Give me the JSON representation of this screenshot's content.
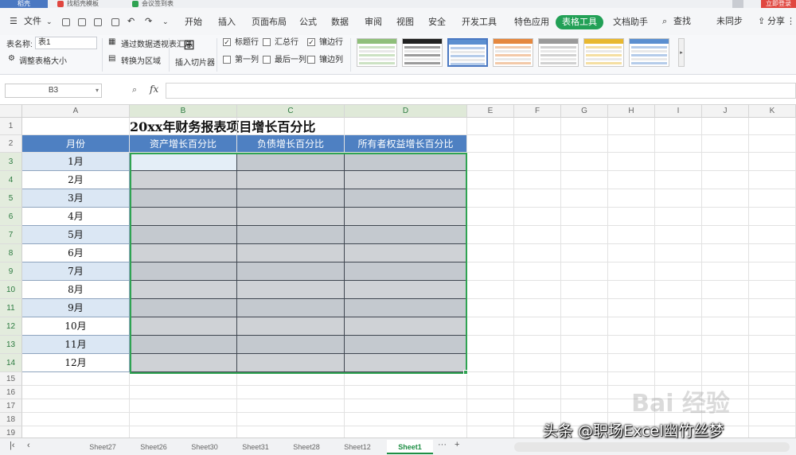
{
  "titlebar": {
    "home_tab": "稻壳",
    "doc_tabs": [
      {
        "label": "找稻壳模板",
        "color": "#e0463f"
      },
      {
        "label": "会议签到表",
        "color": "#2fa352"
      }
    ],
    "login_button": "立即登录"
  },
  "menubar": {
    "quick": "文件",
    "items": [
      "开始",
      "插入",
      "页面布局",
      "公式",
      "数据",
      "审阅",
      "视图",
      "安全",
      "开发工具",
      "特色应用",
      "表格工具",
      "文档助手"
    ],
    "active_index": 10,
    "search": "查找",
    "unsync": "未同步",
    "share": "分享"
  },
  "ribbon": {
    "table_name_label": "表名称:",
    "table_name_value": "表1",
    "resize_table": "调整表格大小",
    "summary_pivot": "通过数据透视表汇总",
    "convert_range": "转换为区域",
    "slicer": "插入切片器",
    "options": [
      {
        "label": "标题行",
        "checked": true
      },
      {
        "label": "汇总行",
        "checked": false
      },
      {
        "label": "镶边行",
        "checked": true
      },
      {
        "label": "第一列",
        "checked": false
      },
      {
        "label": "最后一列",
        "checked": false
      },
      {
        "label": "镶边列",
        "checked": false
      }
    ],
    "style_colors": [
      "#8fbf7a",
      "#222222",
      "#5b8fd0",
      "#e5883f",
      "#9a9a9a",
      "#e8b830",
      "#5b8fd0"
    ]
  },
  "formula_bar": {
    "name_box": "B3",
    "fx": "fx",
    "value": ""
  },
  "sheet": {
    "columns": [
      "A",
      "B",
      "C",
      "D",
      "E",
      "F",
      "G",
      "H",
      "I",
      "J",
      "K"
    ],
    "rows": [
      "1",
      "2",
      "3",
      "4",
      "5",
      "6",
      "7",
      "8",
      "9",
      "10",
      "11",
      "12",
      "13",
      "14",
      "15",
      "16",
      "17",
      "18",
      "19"
    ],
    "title": "20xx年财务报表项目增长百分比",
    "headers": [
      "月份",
      "资产增长百分比",
      "负债增长百分比",
      "所有者权益增长百分比"
    ],
    "months": [
      "1月",
      "2月",
      "3月",
      "4月",
      "5月",
      "6月",
      "7月",
      "8月",
      "9月",
      "10月",
      "11月",
      "12月"
    ],
    "colors": {
      "header": "#4e80c2",
      "band_light": "#dbe7f4",
      "band_white": "#ffffff",
      "data_fill": "#cfd2d6",
      "data_fill_alt": "#c4c9cf",
      "active_cell": "#e4eef7",
      "selection": "#2fa352"
    }
  },
  "tabs": {
    "sheets": [
      "Sheet27",
      "Sheet26",
      "Sheet30",
      "Sheet31",
      "Sheet28",
      "Sheet12",
      "Sheet1"
    ],
    "active_index": 6,
    "more": "···",
    "add": "+"
  },
  "overlay": {
    "watermark": "Bai 经验",
    "credit": "头条 @职场Excel幽竹丝梦"
  }
}
